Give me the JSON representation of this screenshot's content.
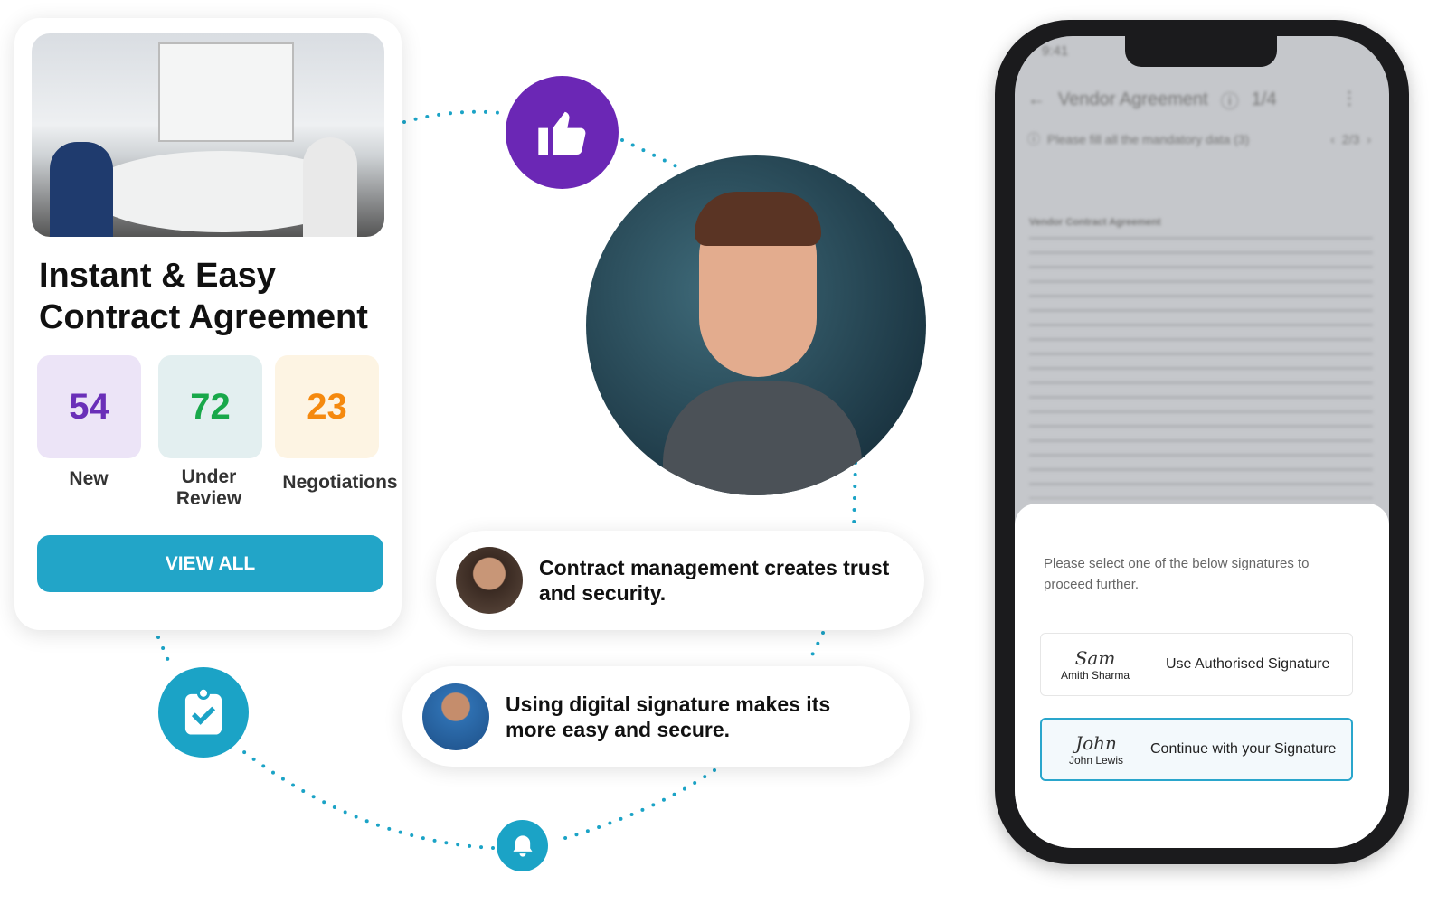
{
  "card": {
    "title_line1": "Instant & Easy",
    "title_line2": "Contract Agreement",
    "stats": [
      {
        "value": "54",
        "label": "New",
        "color": "#6a2fb8",
        "bg": "#ece4f7"
      },
      {
        "value": "72",
        "label": "Under Review",
        "color": "#18a84a",
        "bg": "#e3eff0"
      },
      {
        "value": "23",
        "label": "Negotiations",
        "color": "#f5890e",
        "bg": "#fdf4e3"
      }
    ],
    "button": "VIEW ALL"
  },
  "quotes": [
    {
      "text": "Contract management  creates trust and security."
    },
    {
      "text": "Using digital signature makes its more easy and secure."
    }
  ],
  "icons": {
    "thumbs": "thumbs-up-icon",
    "clipboard": "clipboard-check-icon",
    "bell": "bell-icon",
    "accent": "#1ba3c6",
    "purple": "#6b27b5"
  },
  "phone": {
    "time": "9:41",
    "header_title": "Vendor Agreement",
    "page": "1/4",
    "notice": "Please fill all the mandatory data (3)",
    "notice_page": "2/3",
    "doc_title": "Vendor Contract Agreement",
    "prompt": "Please select one of the below signatures to proceed further.",
    "signatures": [
      {
        "cursive": "Sam",
        "name": "Amith Sharma",
        "action": "Use Authorised Signature"
      },
      {
        "cursive": "John",
        "name": "John Lewis",
        "action": "Continue with your Signature"
      }
    ]
  }
}
